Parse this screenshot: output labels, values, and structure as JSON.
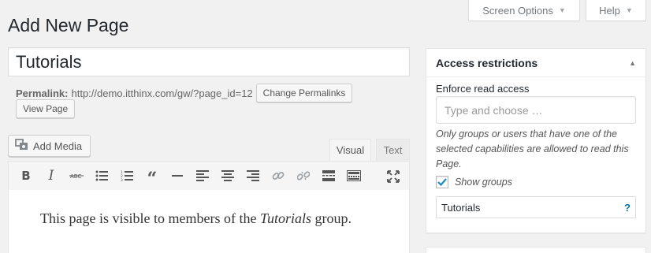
{
  "screen_meta": {
    "screen_options_label": "Screen Options",
    "help_label": "Help"
  },
  "page": {
    "title": "Add New Page"
  },
  "editor": {
    "post_title": "Tutorials",
    "permalink_label": "Permalink:",
    "permalink_url": "http://demo.itthinx.com/gw/?page_id=12",
    "change_permalinks_label": "Change Permalinks",
    "view_page_label": "View Page",
    "add_media_label": "Add Media",
    "tabs": {
      "visual": "Visual",
      "text": "Text"
    },
    "toolbar_icons": [
      "bold-icon",
      "italic-icon",
      "strikethrough-icon",
      "bullet-list-icon",
      "numbered-list-icon",
      "blockquote-icon",
      "horizontal-rule-icon",
      "align-left-icon",
      "align-center-icon",
      "align-right-icon",
      "link-icon",
      "unlink-icon",
      "read-more-icon",
      "toolbar-toggle-icon",
      "fullscreen-icon"
    ],
    "content": {
      "before": "This page is visible to members of the ",
      "emphasis": "Tutorials",
      "after": " group."
    }
  },
  "access_restrictions": {
    "title": "Access restrictions",
    "enforce_label": "Enforce read access",
    "placeholder": "Type and choose …",
    "help_text": "Only groups or users that have one of the selected capabilities are allowed to read this Page.",
    "show_groups_label": "Show groups",
    "show_groups_checked": true,
    "group_value": "Tutorials",
    "help_glyph": "?"
  },
  "colors": {
    "accent": "#0073aa"
  }
}
